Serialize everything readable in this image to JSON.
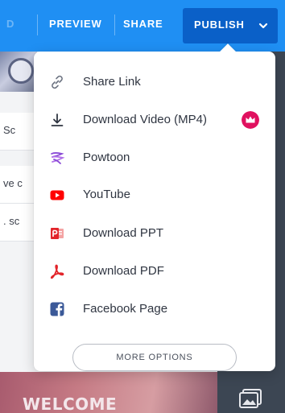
{
  "topbar": {
    "faded_item": "D",
    "preview_label": "PREVIEW",
    "share_label": "SHARE",
    "publish_label": "PUBLISH",
    "background_color": "#1f8ff3",
    "publish_color": "#0a60c8"
  },
  "background": {
    "row_texts": [
      "Sc",
      "ve c",
      ". sc"
    ],
    "welcome_text": "WELCOME",
    "right_panel_icon": "picture-icon"
  },
  "dropdown": {
    "items": [
      {
        "label": "Share Link",
        "icon": "link-icon",
        "icon_color": "#6b7280"
      },
      {
        "label": "Download Video (MP4)",
        "icon": "download-icon",
        "icon_color": "#2f3541",
        "premium_badge": "crown-icon",
        "premium_color": "#e0115f"
      },
      {
        "label": "Powtoon",
        "icon": "powtoon-logo-icon",
        "icon_color": "#8a4bd6"
      },
      {
        "label": "YouTube",
        "icon": "youtube-icon",
        "icon_color": "#ff0000"
      },
      {
        "label": "Download PPT",
        "icon": "powerpoint-icon",
        "icon_color": "#e2242a"
      },
      {
        "label": "Download PDF",
        "icon": "pdf-icon",
        "icon_color": "#e2242a"
      },
      {
        "label": "Facebook Page",
        "icon": "facebook-icon",
        "icon_color": "#3b5998"
      }
    ],
    "more_options_label": "MORE OPTIONS"
  }
}
